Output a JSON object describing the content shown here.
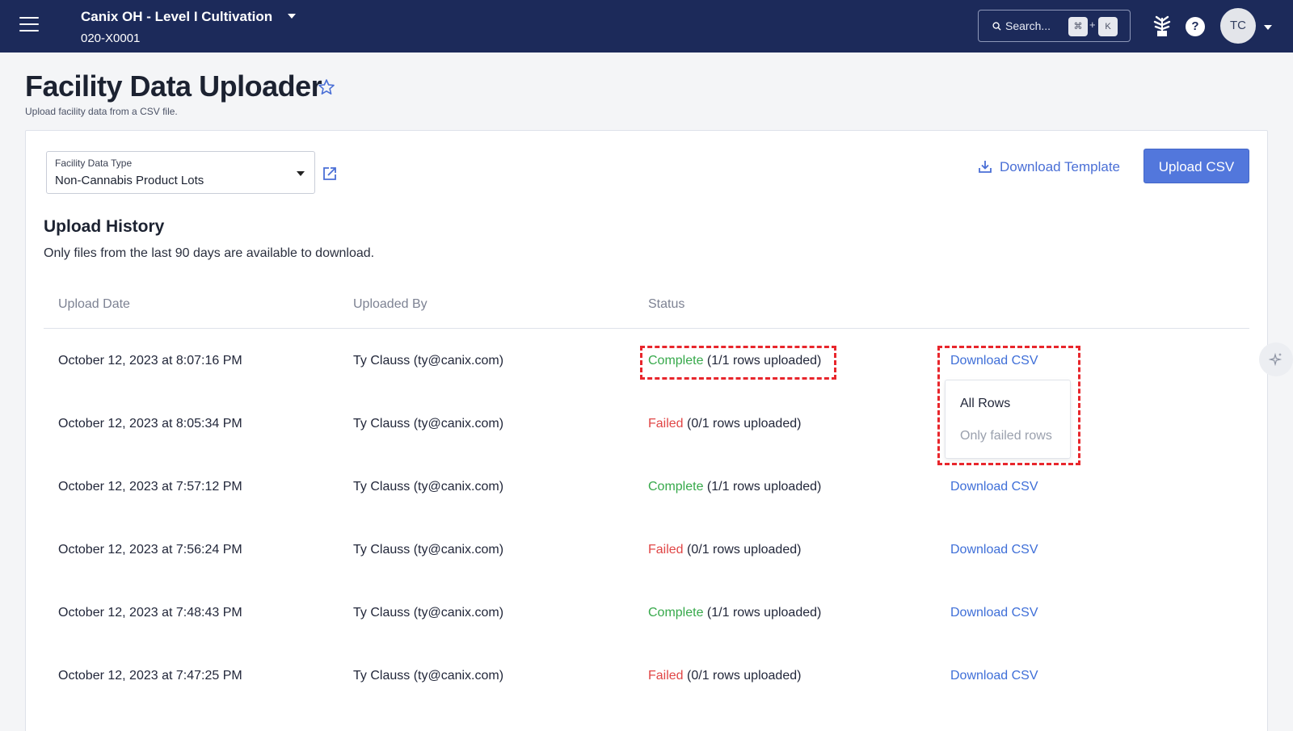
{
  "header": {
    "org_name": "Canix OH - Level I Cultivation",
    "org_code": "020-X0001",
    "search_placeholder": "Search...",
    "shortcut_mod": "⌘",
    "shortcut_plus": "+",
    "shortcut_key": "K",
    "help_label": "?",
    "avatar_initials": "TC"
  },
  "page": {
    "title": "Facility Data Uploader",
    "subtitle": "Upload facility data from a CSV file."
  },
  "controls": {
    "data_type_label": "Facility Data Type",
    "data_type_value": "Non-Cannabis Product Lots",
    "download_template_label": "Download Template",
    "upload_csv_label": "Upload CSV"
  },
  "history": {
    "title": "Upload History",
    "note": "Only files from the last 90 days are available to download.",
    "columns": [
      "Upload Date",
      "Uploaded By",
      "Status"
    ],
    "rows": [
      {
        "date": "October 12, 2023 at 8:07:16 PM",
        "user": "Ty Clauss (ty@canix.com)",
        "status": "Complete",
        "status_detail": " (1/1 rows uploaded)",
        "action": "Download CSV"
      },
      {
        "date": "October 12, 2023 at 8:05:34 PM",
        "user": "Ty Clauss (ty@canix.com)",
        "status": "Failed",
        "status_detail": " (0/1 rows uploaded)",
        "action": ""
      },
      {
        "date": "October 12, 2023 at 7:57:12 PM",
        "user": "Ty Clauss (ty@canix.com)",
        "status": "Complete",
        "status_detail": " (1/1 rows uploaded)",
        "action": "Download CSV"
      },
      {
        "date": "October 12, 2023 at 7:56:24 PM",
        "user": "Ty Clauss (ty@canix.com)",
        "status": "Failed",
        "status_detail": " (0/1 rows uploaded)",
        "action": "Download CSV"
      },
      {
        "date": "October 12, 2023 at 7:48:43 PM",
        "user": "Ty Clauss (ty@canix.com)",
        "status": "Complete",
        "status_detail": " (1/1 rows uploaded)",
        "action": "Download CSV"
      },
      {
        "date": "October 12, 2023 at 7:47:25 PM",
        "user": "Ty Clauss (ty@canix.com)",
        "status": "Failed",
        "status_detail": " (0/1 rows uploaded)",
        "action": "Download CSV"
      }
    ],
    "download_menu": {
      "all_rows": "All Rows",
      "failed_rows": "Only failed rows"
    }
  },
  "colors": {
    "topbar": "#1c2a5a",
    "accent": "#5277dc",
    "complete": "#37a94b",
    "failed": "#e04646",
    "highlight": "#e8262c"
  }
}
